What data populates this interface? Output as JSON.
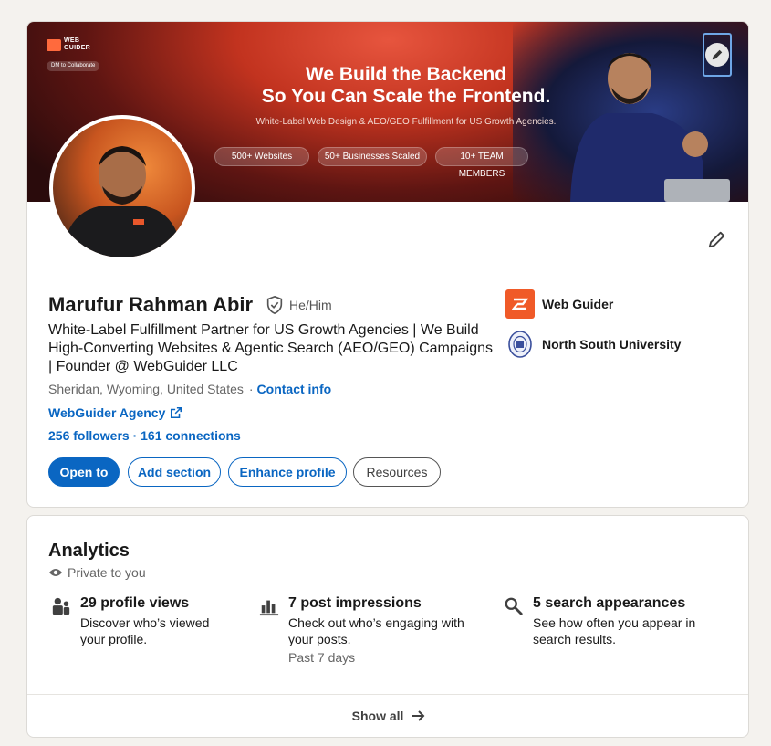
{
  "banner": {
    "brand": "WEB GUIDER",
    "dm_pill": "DM to Collaborate",
    "headline_line1": "We Build the Backend",
    "headline_line2": "So You Can Scale the Frontend.",
    "subheadline": "White-Label Web Design & AEO/GEO Fulfillment for US Growth Agencies.",
    "pills": [
      "500+ Websites",
      "50+ Businesses Scaled",
      "10+ TEAM MEMBERS"
    ],
    "edit_icon": "pencil-icon"
  },
  "profile": {
    "name": "Marufur Rahman Abir",
    "pronouns": "He/Him",
    "headline": "White-Label Fulfillment Partner for US Growth Agencies | We Build High-Converting Websites & Agentic Search (AEO/GEO) Campaigns | Founder @ WebGuider LLC",
    "location": "Sheridan, Wyoming, United States",
    "contact_info": "Contact info",
    "website_label": "WebGuider Agency",
    "followers": "256 followers · 161 connections",
    "buttons": {
      "open_to": "Open to",
      "add_section": "Add section",
      "enhance_profile": "Enhance profile",
      "resources": "Resources"
    },
    "organizations": [
      {
        "name": "Web Guider",
        "color": "#f05a28"
      },
      {
        "name": "North South University",
        "color": "#3a4f9c"
      }
    ]
  },
  "analytics": {
    "title": "Analytics",
    "visibility": "Private to you",
    "metrics": [
      {
        "icon": "people-icon",
        "title": "29 profile views",
        "desc": "Discover who’s viewed your profile.",
        "note": ""
      },
      {
        "icon": "bar-chart-icon",
        "title": "7 post impressions",
        "desc": "Check out who’s engaging with your posts.",
        "note": "Past 7 days"
      },
      {
        "icon": "search-icon",
        "title": "5 search appearances",
        "desc": "See how often you appear in search results.",
        "note": ""
      }
    ],
    "show_all": "Show all"
  },
  "colors": {
    "accent": "#0a66c2",
    "page_bg": "#f4f2ee"
  }
}
